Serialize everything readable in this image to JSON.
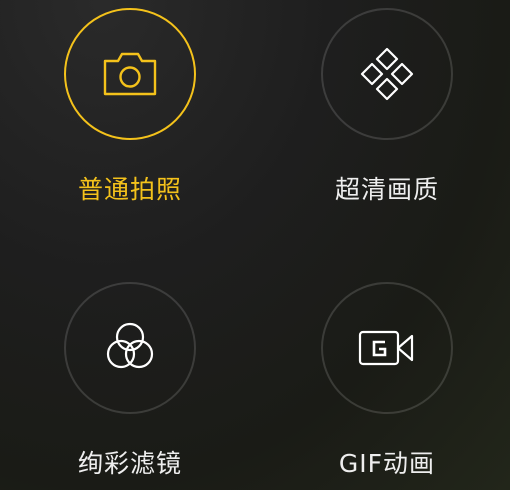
{
  "colors": {
    "accent": "#f4c21b",
    "text": "#eeeeee",
    "ring": "#3a3a3a"
  },
  "modes": [
    {
      "label": "普通拍照",
      "icon": "camera-icon",
      "selected": true
    },
    {
      "label": "超清画质",
      "icon": "diamond-grid-icon",
      "selected": false
    },
    {
      "label": "绚彩滤镜",
      "icon": "color-circles-icon",
      "selected": false
    },
    {
      "label": "GIF动画",
      "icon": "gif-video-icon",
      "selected": false
    }
  ]
}
